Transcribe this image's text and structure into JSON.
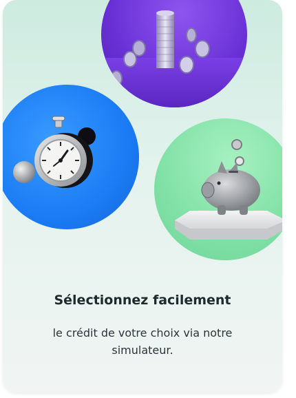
{
  "card": {
    "title": "Sélectionnez facilement",
    "description": "le crédit de votre choix via notre simulateur.",
    "illustrations": [
      "coins-stack-icon",
      "stopwatch-icon",
      "piggy-bank-icon"
    ]
  },
  "colors": {
    "card_top": "#cdebe0",
    "card_bottom": "#f1f4f3",
    "purple_circle": "#6a31d6",
    "blue_circle": "#1b7cf5",
    "green_circle": "#82e2a7",
    "title_text": "#1d2b2e",
    "body_text": "#2b3538"
  }
}
